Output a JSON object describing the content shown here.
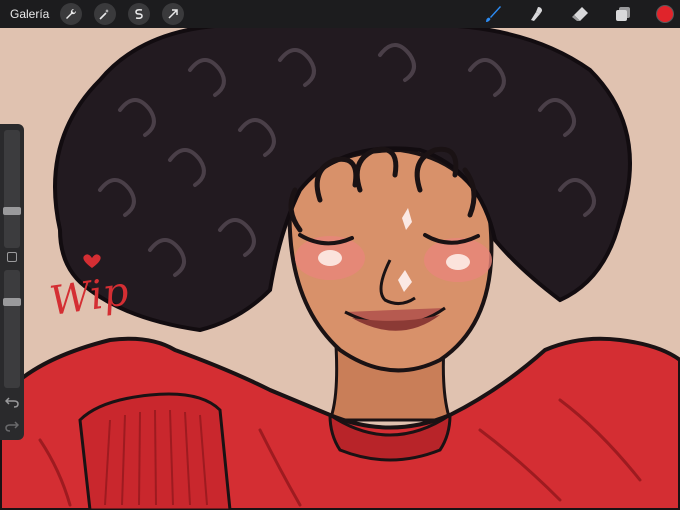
{
  "toolbar": {
    "gallery_label": "Galería",
    "left_tools": [
      "wrench-icon",
      "magic-wand-icon",
      "selection-s-icon",
      "arrow-icon"
    ],
    "right_tools": [
      "brush-icon",
      "smudge-icon",
      "eraser-icon",
      "layers-icon"
    ],
    "active_tool": "brush-icon",
    "accent": "#2c8cf4",
    "current_color": "#e0242b"
  },
  "sidebar": {
    "brush_size": 0.3,
    "opacity": 0.75,
    "icons": [
      "modifier-square-icon",
      "undo-icon",
      "redo-icon"
    ]
  },
  "artwork": {
    "signature_text": "Wip",
    "background": "#e0c2b0",
    "sweater_color": "#d42e33",
    "hair_color": "#221a20",
    "skin_color": "#d8916a"
  }
}
